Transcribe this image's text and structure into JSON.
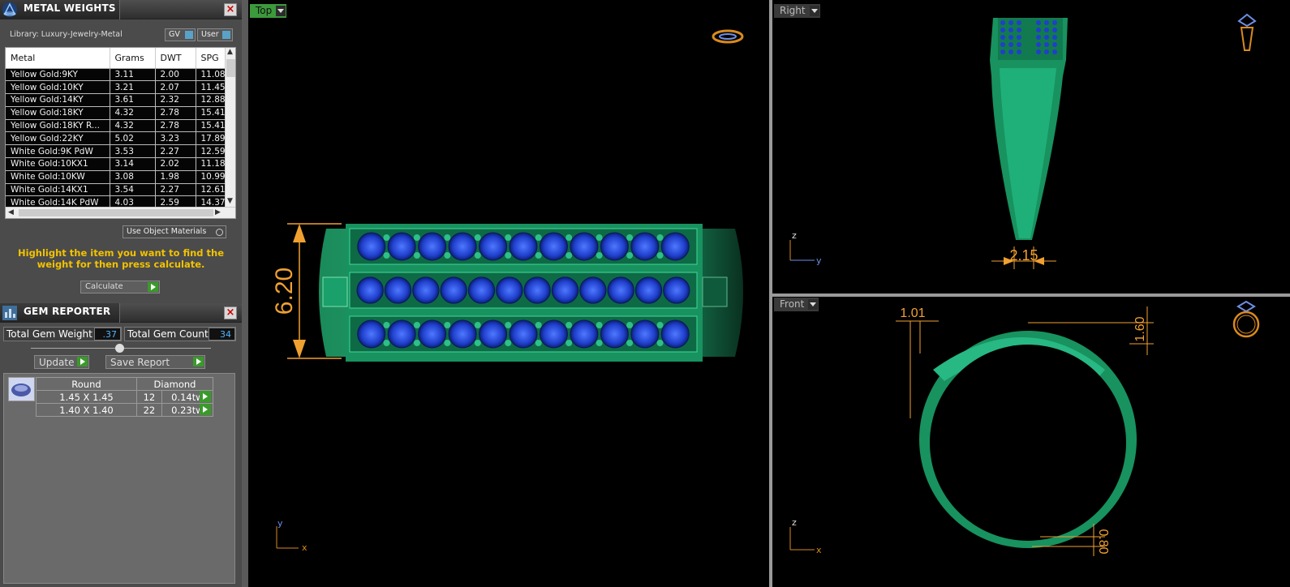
{
  "metal_panel": {
    "title": "METAL WEIGHTS",
    "library": "Library: Luxury-Jewelry-Metal",
    "gv_label": "GV",
    "user_label": "User",
    "columns": [
      "Metal",
      "Grams",
      "DWT",
      "SPG"
    ],
    "rows": [
      [
        "Yellow Gold:9KY",
        "3.11",
        "2.00",
        "11.08"
      ],
      [
        "Yellow Gold:10KY",
        "3.21",
        "2.07",
        "11.45"
      ],
      [
        "Yellow Gold:14KY",
        "3.61",
        "2.32",
        "12.88"
      ],
      [
        "Yellow Gold:18KY",
        "4.32",
        "2.78",
        "15.41"
      ],
      [
        "Yellow Gold:18KY R...",
        "4.32",
        "2.78",
        "15.41"
      ],
      [
        "Yellow Gold:22KY",
        "5.02",
        "3.23",
        "17.89"
      ],
      [
        "White Gold:9K PdW",
        "3.53",
        "2.27",
        "12.59"
      ],
      [
        "White Gold:10KX1",
        "3.14",
        "2.02",
        "11.18"
      ],
      [
        "White Gold:10KW",
        "3.08",
        "1.98",
        "10.99"
      ],
      [
        "White Gold:14KX1",
        "3.54",
        "2.27",
        "12.61"
      ],
      [
        "White Gold:14K PdW",
        "4.03",
        "2.59",
        "14.37"
      ]
    ],
    "use_object_materials": "Use Object Materials",
    "hint": "Highlight the item you want to find the weight for then press calculate.",
    "calculate": "Calculate"
  },
  "gem_panel": {
    "title": "GEM REPORTER",
    "total_weight_label": "Total Gem Weight",
    "total_weight_value": ".37",
    "total_count_label": "Total Gem Count",
    "total_count_value": "34",
    "update": "Update",
    "save_report": "Save Report",
    "header": [
      "Round",
      "Diamond"
    ],
    "rows": [
      [
        "1.45 X 1.45",
        "12",
        "0.14tw"
      ],
      [
        "1.40 X 1.40",
        "22",
        "0.23tw"
      ]
    ]
  },
  "viewports": {
    "top": {
      "label": "Top",
      "dim": "6.20",
      "axis_y": "y",
      "axis_x": "x"
    },
    "right": {
      "label": "Right",
      "dim": "2.15",
      "axis_z": "z",
      "axis_y": "y"
    },
    "front": {
      "label": "Front",
      "dim_a": "1.01",
      "dim_b": "1.60",
      "dim_c": "0.80",
      "axis_z": "z",
      "axis_x": "x"
    }
  },
  "colors": {
    "metal": "#1fa870",
    "stone": "#1f3fcc",
    "dimension": "#f0a030",
    "panel": "#4b4b4b"
  }
}
